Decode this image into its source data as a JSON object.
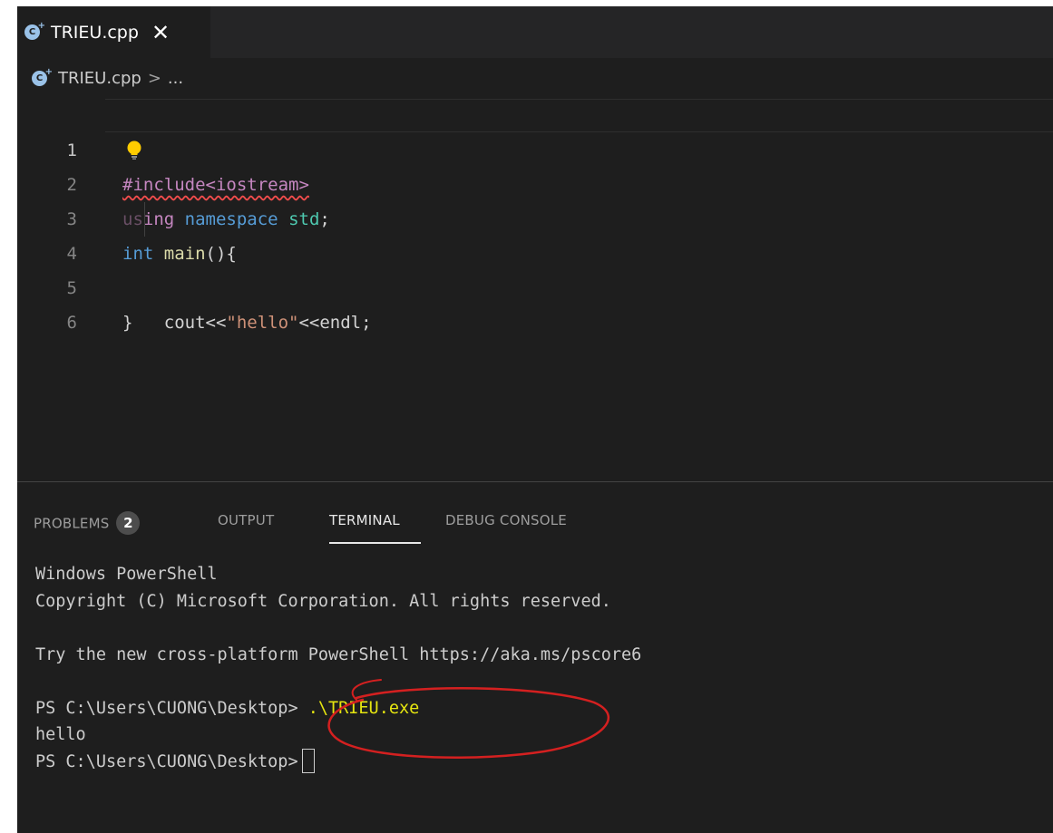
{
  "editor": {
    "tab": {
      "icon": "cpp-file-icon",
      "label": "TRIEU.cpp",
      "close_glyph": "✕"
    },
    "breadcrumb": {
      "icon": "cpp-file-icon",
      "file": "TRIEU.cpp",
      "separator": ">",
      "more": "..."
    },
    "lines": [
      {
        "number": "1",
        "text": "#include<iostream>"
      },
      {
        "number": "2",
        "text": "using namespace std;"
      },
      {
        "number": "3",
        "text": "int main(){"
      },
      {
        "number": "4",
        "text": "    cout<<\"hello\"<<endl;"
      },
      {
        "number": "5",
        "text": "}"
      },
      {
        "number": "6",
        "text": ""
      }
    ],
    "line2_parts": {
      "hidden": "us",
      "rest": "ing",
      "namespace": "namespace",
      "std": "std",
      "semicolon": ";"
    },
    "line3_parts": {
      "int": "int",
      "main": "main",
      "tail": "(){"
    },
    "line4_parts": {
      "cout": "cout<<",
      "string": "\"hello\"",
      "endl": "<<endl;"
    },
    "lightbulb_icon": "lightbulb-icon"
  },
  "panel": {
    "tabs": [
      {
        "label": "PROBLEMS",
        "badge": "2"
      },
      {
        "label": "OUTPUT"
      },
      {
        "label": "TERMINAL",
        "active": true
      },
      {
        "label": "DEBUG CONSOLE"
      }
    ],
    "terminal": {
      "lines": [
        "Windows PowerShell",
        "Copyright (C) Microsoft Corporation. All rights reserved.",
        "",
        "Try the new cross-platform PowerShell https://aka.ms/pscore6",
        ""
      ],
      "prompt": "PS C:\\Users\\CUONG\\Desktop>",
      "command": ".\\TRIEU.exe",
      "output": "hello",
      "prompt2": "PS C:\\Users\\CUONG\\Desktop>"
    }
  },
  "colors": {
    "editor_bg": "#1e1e1e",
    "tabbar_bg": "#252526",
    "keyword": "#569cd6",
    "preprocessor": "#c586c0",
    "type_namespace": "#4ec9b0",
    "function": "#dcdcaa",
    "string": "#ce9178",
    "terminal_command": "#e5e510",
    "annotation_red": "#d42020"
  }
}
